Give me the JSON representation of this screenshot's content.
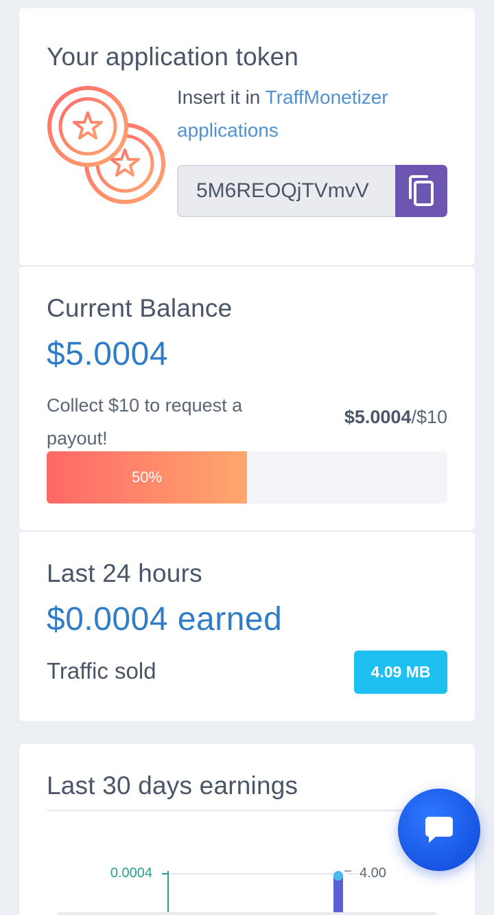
{
  "token_card": {
    "title": "Your application token",
    "instruction_prefix": "Insert it in",
    "instruction_link": "TraffMonetizer applications",
    "token_value": "5M6REOQjTVmvV",
    "copy_icon": "copy-icon",
    "coins_icon": "coins-star-icon"
  },
  "balance_card": {
    "title": "Current Balance",
    "balance": "$5.0004",
    "collect_text": "Collect $10 to request a payout!",
    "ratio_current": "$5.0004",
    "ratio_target": "/$10",
    "progress_label": "50%",
    "progress_fraction": 0.5
  },
  "last24_card": {
    "title": "Last 24 hours",
    "earned": "$0.0004 earned",
    "traffic_label": "Traffic sold",
    "traffic_value": "4.09 MB"
  },
  "last30_card": {
    "title": "Last 30 days earnings"
  },
  "chart_data": {
    "type": "bar",
    "left_axis_ticks": [
      "0.0004"
    ],
    "right_axis_ticks": [
      "4.00"
    ],
    "colors": {
      "left_axis": "#2a9d8f",
      "bar": "#5b5fd6"
    }
  },
  "chat_button": {
    "icon": "chat-bubble-icon"
  },
  "colors": {
    "accent_blue": "#2f7dc8",
    "link_blue": "#4f92d1",
    "copy_button": "#6d55b2",
    "badge_cyan": "#1ec0f2",
    "progress_start": "#ff6868",
    "progress_end": "#ffa76c"
  }
}
